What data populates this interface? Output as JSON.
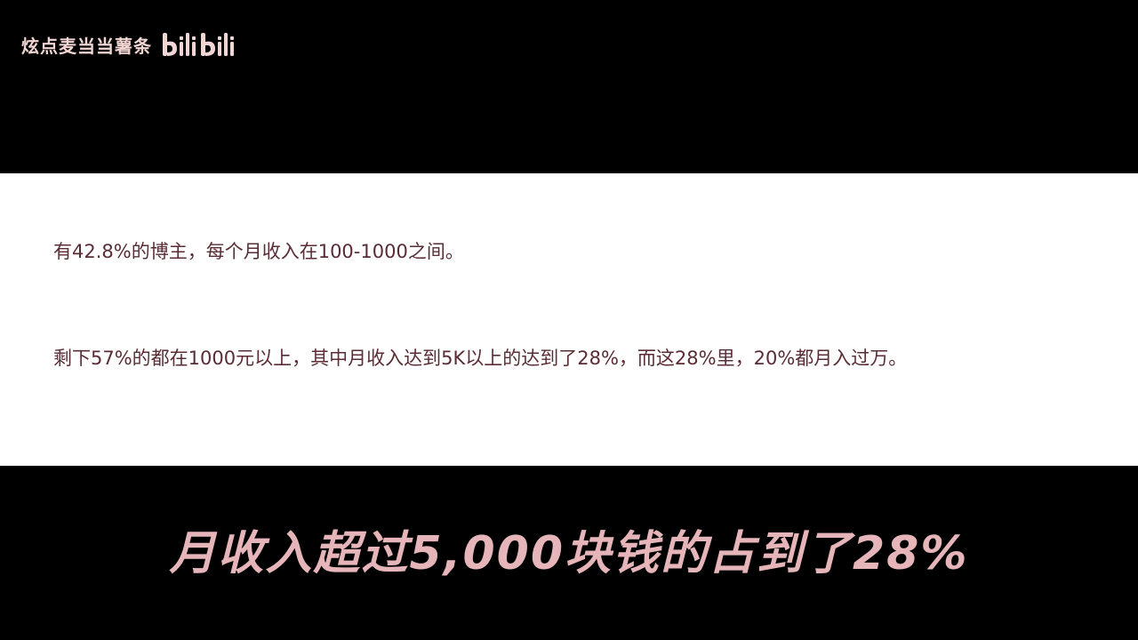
{
  "watermark": {
    "channel_name": "炫点麦当当薯条",
    "logo_icon": "bilibili-logo-icon",
    "logo_color": "#f1d6d3"
  },
  "article": {
    "paragraphs": [
      "有42.8%的博主，每个月收入在100-1000之间。",
      "剩下57%的都在1000元以上，其中月收入达到5K以上的达到了28%，而这28%里，20%都月入过万。"
    ]
  },
  "subtitle": {
    "text": "月收入超过5,000块钱的占到了28%",
    "color": "#e6b5b9"
  }
}
